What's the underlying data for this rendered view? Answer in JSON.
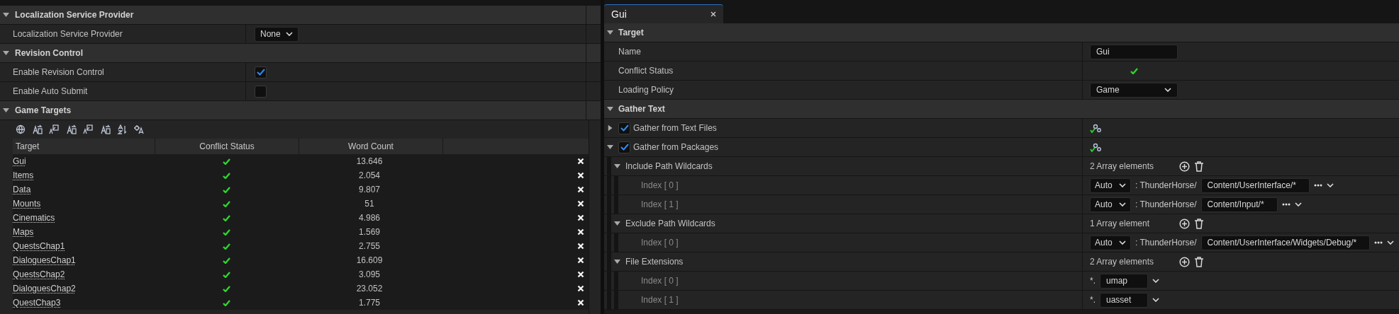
{
  "left_panel": {
    "sections": [
      {
        "title": "Localization Service Provider",
        "expanded": true,
        "rows": [
          {
            "kind": "dropdown",
            "label": "Localization Service Provider",
            "value": "None"
          }
        ]
      },
      {
        "title": "Revision Control",
        "expanded": true,
        "rows": [
          {
            "kind": "checkbox",
            "label": "Enable Revision Control",
            "checked": true
          },
          {
            "kind": "checkbox",
            "label": "Enable Auto Submit",
            "checked": false
          }
        ]
      },
      {
        "title": "Game Targets",
        "expanded": true
      }
    ],
    "targets_table": {
      "columns": [
        "Target",
        "Conflict Status",
        "Word Count"
      ],
      "rows": [
        {
          "target": "Gui",
          "resolved": true,
          "word_count": "13.646"
        },
        {
          "target": "Items",
          "resolved": true,
          "word_count": "2.054"
        },
        {
          "target": "Data",
          "resolved": true,
          "word_count": "9.807"
        },
        {
          "target": "Mounts",
          "resolved": true,
          "word_count": "51"
        },
        {
          "target": "Cinematics",
          "resolved": true,
          "word_count": "4.986"
        },
        {
          "target": "Maps",
          "resolved": true,
          "word_count": "1.569"
        },
        {
          "target": "QuestsChap1",
          "resolved": true,
          "word_count": "2.755"
        },
        {
          "target": "DialoguesChap1",
          "resolved": true,
          "word_count": "16.609"
        },
        {
          "target": "QuestsChap2",
          "resolved": true,
          "word_count": "3.095"
        },
        {
          "target": "DialoguesChap2",
          "resolved": true,
          "word_count": "23.052"
        },
        {
          "target": "QuestChap3",
          "resolved": true,
          "word_count": "1.775"
        }
      ]
    }
  },
  "tab": {
    "title": "Gui",
    "selected": true
  },
  "details": [
    {
      "kind": "category",
      "label": "Target",
      "expanded": true,
      "children": [
        {
          "kind": "text_field",
          "label": "Name",
          "value": "Gui"
        },
        {
          "kind": "status",
          "label": "Conflict Status",
          "ok": true
        },
        {
          "kind": "dropdown",
          "label": "Loading Policy",
          "value": "Game"
        }
      ]
    },
    {
      "kind": "category",
      "label": "Gather Text",
      "expanded": true,
      "children": [
        {
          "kind": "toggle_group",
          "label": "Gather from Text Files",
          "checked": true,
          "expanded": false
        },
        {
          "kind": "toggle_group",
          "label": "Gather from Packages",
          "checked": true,
          "expanded": true,
          "children": [
            {
              "kind": "array",
              "label": "Include Path Wildcards",
              "count": "2 Array elements",
              "expanded": true,
              "children": [
                {
                  "kind": "path",
                  "label": "Index [ 0 ]",
                  "mode": "Auto",
                  "prefix": ": ThunderHorse/",
                  "value": "Content/UserInterface/*"
                },
                {
                  "kind": "path",
                  "label": "Index [ 1 ]",
                  "mode": "Auto",
                  "prefix": ": ThunderHorse/",
                  "value": "Content/Input/*"
                }
              ]
            },
            {
              "kind": "array",
              "label": "Exclude Path Wildcards",
              "count": "1 Array element",
              "expanded": true,
              "children": [
                {
                  "kind": "path",
                  "label": "Index [ 0 ]",
                  "mode": "Auto",
                  "prefix": ": ThunderHorse/",
                  "value": "Content/UserInterface/Widgets/Debug/*"
                }
              ]
            },
            {
              "kind": "array",
              "label": "File Extensions",
              "count": "2 Array elements",
              "expanded": true,
              "children": [
                {
                  "kind": "extension",
                  "label": "Index [ 0 ]",
                  "prefix": "*.",
                  "value": "umap"
                },
                {
                  "kind": "extension",
                  "label": "Index [ 1 ]",
                  "prefix": "*.",
                  "value": "uasset"
                }
              ]
            }
          ]
        }
      ]
    }
  ]
}
